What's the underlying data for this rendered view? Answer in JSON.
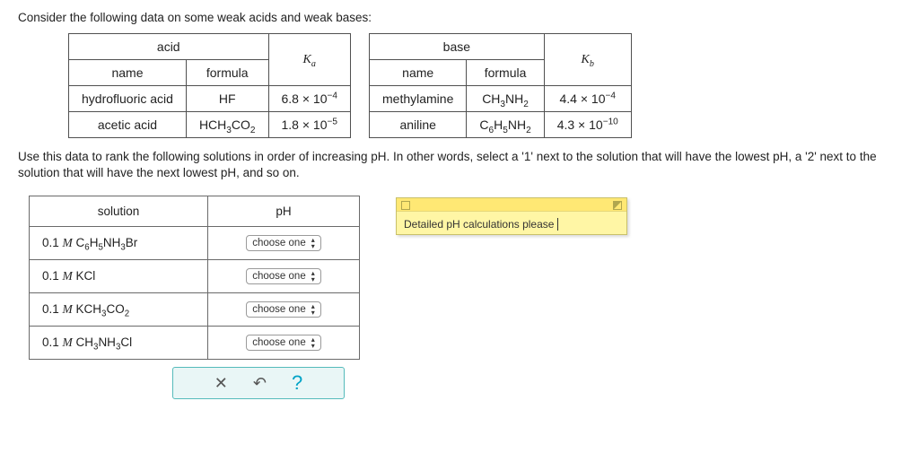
{
  "intro": "Consider the following data on some weak acids and weak bases:",
  "acid_table": {
    "group_header": "acid",
    "name_header": "name",
    "formula_header": "formula",
    "k_header_html": "K<span class='sub serif-i'>a</span>",
    "rows": [
      {
        "name": "hydrofluoric acid",
        "formula_html": "HF",
        "k_html": "6.8 × 10<span class='sup'>−4</span>"
      },
      {
        "name": "acetic acid",
        "formula_html": "HCH<span class='sub'>3</span>CO<span class='sub'>2</span>",
        "k_html": "1.8 × 10<span class='sup'>−5</span>"
      }
    ]
  },
  "base_table": {
    "group_header": "base",
    "name_header": "name",
    "formula_header": "formula",
    "k_header_html": "K<span class='sub serif-i'>b</span>",
    "rows": [
      {
        "name": "methylamine",
        "formula_html": "CH<span class='sub'>3</span>NH<span class='sub'>2</span>",
        "k_html": "4.4 × 10<span class='sup'>−4</span>"
      },
      {
        "name": "aniline",
        "formula_html": "C<span class='sub'>6</span>H<span class='sub'>5</span>NH<span class='sub'>2</span>",
        "k_html": "4.3 × 10<span class='sup'>−10</span>"
      }
    ]
  },
  "instructions": "Use this data to rank the following solutions in order of increasing pH. In other words, select a '1' next to the solution that will have the lowest pH, a '2' next to the solution that will have the next lowest pH, and so on.",
  "solution_table": {
    "header_solution": "solution",
    "header_ph": "pH",
    "placeholder": "choose one",
    "rows": [
      "0.1 <span class='serif-i'>M</span> C<span class='sub'>6</span>H<span class='sub'>5</span>NH<span class='sub'>3</span>Br",
      "0.1 <span class='serif-i'>M</span> KCl",
      "0.1 <span class='serif-i'>M</span> KCH<span class='sub'>3</span>CO<span class='sub'>2</span>",
      "0.1 <span class='serif-i'>M</span> CH<span class='sub'>3</span>NH<span class='sub'>3</span>Cl"
    ]
  },
  "buttons": {
    "close": "✕",
    "undo": "↶",
    "help": "?"
  },
  "note_text": "Detailed pH calculations please"
}
